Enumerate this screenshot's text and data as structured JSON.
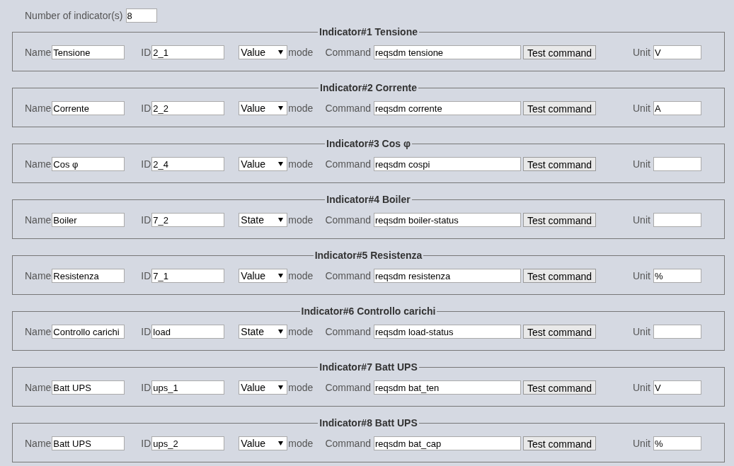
{
  "count": {
    "label": "Number of indicator(s)",
    "value": "8"
  },
  "indicators": [
    {
      "legend": "Indicator#1 Tensione",
      "name_label": "Name",
      "name": "Tensione",
      "id_label": "ID",
      "id": "2_1",
      "mode": "Value",
      "mode_label": "mode",
      "command_label": "Command",
      "command": "reqsdm tensione",
      "button": "Test command",
      "unit_label": "Unit",
      "unit": "V"
    },
    {
      "legend": "Indicator#2 Corrente",
      "name_label": "Name",
      "name": "Corrente",
      "id_label": "ID",
      "id": "2_2",
      "mode": "Value",
      "mode_label": "mode",
      "command_label": "Command",
      "command": "reqsdm corrente",
      "button": "Test command",
      "unit_label": "Unit",
      "unit": "A"
    },
    {
      "legend": "Indicator#3 Cos φ",
      "name_label": "Name",
      "name": "Cos φ",
      "id_label": "ID",
      "id": "2_4",
      "mode": "Value",
      "mode_label": "mode",
      "command_label": "Command",
      "command": "reqsdm cospi",
      "button": "Test command",
      "unit_label": "Unit"
    },
    {
      "legend": "Indicator#4 Boiler",
      "name_label": "Name",
      "name": "Boiler",
      "id_label": "ID",
      "id": "7_2",
      "mode": "State",
      "mode_label": "mode",
      "command_label": "Command",
      "command": "reqsdm boiler-status",
      "button": "Test command",
      "unit_label": "Unit"
    },
    {
      "legend": "Indicator#5 Resistenza",
      "name_label": "Name",
      "name": "Resistenza",
      "id_label": "ID",
      "id": "7_1",
      "mode": "Value",
      "mode_label": "mode",
      "command_label": "Command",
      "command": "reqsdm resistenza",
      "button": "Test command",
      "unit_label": "Unit",
      "unit": "%"
    },
    {
      "legend": "Indicator#6 Controllo carichi",
      "name_label": "Name",
      "name": "Controllo carichi",
      "id_label": "ID",
      "id": "load",
      "mode": "State",
      "mode_label": "mode",
      "command_label": "Command",
      "command": "reqsdm load-status",
      "button": "Test command",
      "unit_label": "Unit"
    },
    {
      "legend": "Indicator#7 Batt UPS",
      "name_label": "Name",
      "name": "Batt UPS",
      "id_label": "ID",
      "id": "ups_1",
      "mode": "Value",
      "mode_label": "mode",
      "command_label": "Command",
      "command": "reqsdm bat_ten",
      "button": "Test command",
      "unit_label": "Unit",
      "unit": "V"
    },
    {
      "legend": "Indicator#8 Batt UPS",
      "name_label": "Name",
      "name": "Batt UPS",
      "id_label": "ID",
      "id": "ups_2",
      "mode": "Value",
      "mode_label": "mode",
      "command_label": "Command",
      "command": "reqsdm bat_cap",
      "button": "Test command",
      "unit_label": "Unit",
      "unit": "%"
    }
  ]
}
